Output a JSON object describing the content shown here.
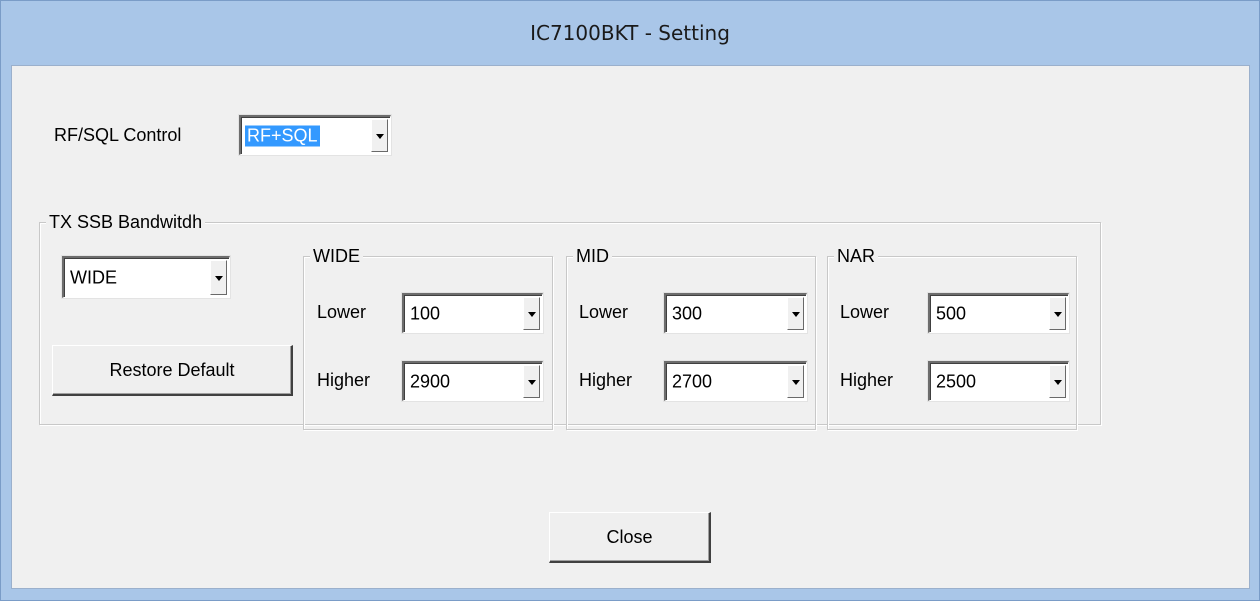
{
  "window": {
    "title": "IC7100BKT - Setting"
  },
  "rf_sql": {
    "label": "RF/SQL Control",
    "value": "RF+SQL"
  },
  "tx_ssb": {
    "title": "TX SSB Bandwitdh",
    "mode_value": "WIDE",
    "restore_label": "Restore Default",
    "groups": [
      {
        "title": "WIDE",
        "lower_label": "Lower",
        "lower_value": "100",
        "higher_label": "Higher",
        "higher_value": "2900"
      },
      {
        "title": "MID",
        "lower_label": "Lower",
        "lower_value": "300",
        "higher_label": "Higher",
        "higher_value": "2700"
      },
      {
        "title": "NAR",
        "lower_label": "Lower",
        "lower_value": "500",
        "higher_label": "Higher",
        "higher_value": "2500"
      }
    ]
  },
  "close_label": "Close",
  "colors": {
    "title_bar": "#a9c6e8",
    "client_bg": "#f0f0f0",
    "selection": "#3399ff"
  },
  "icons": [
    "chevron-down-icon"
  ]
}
